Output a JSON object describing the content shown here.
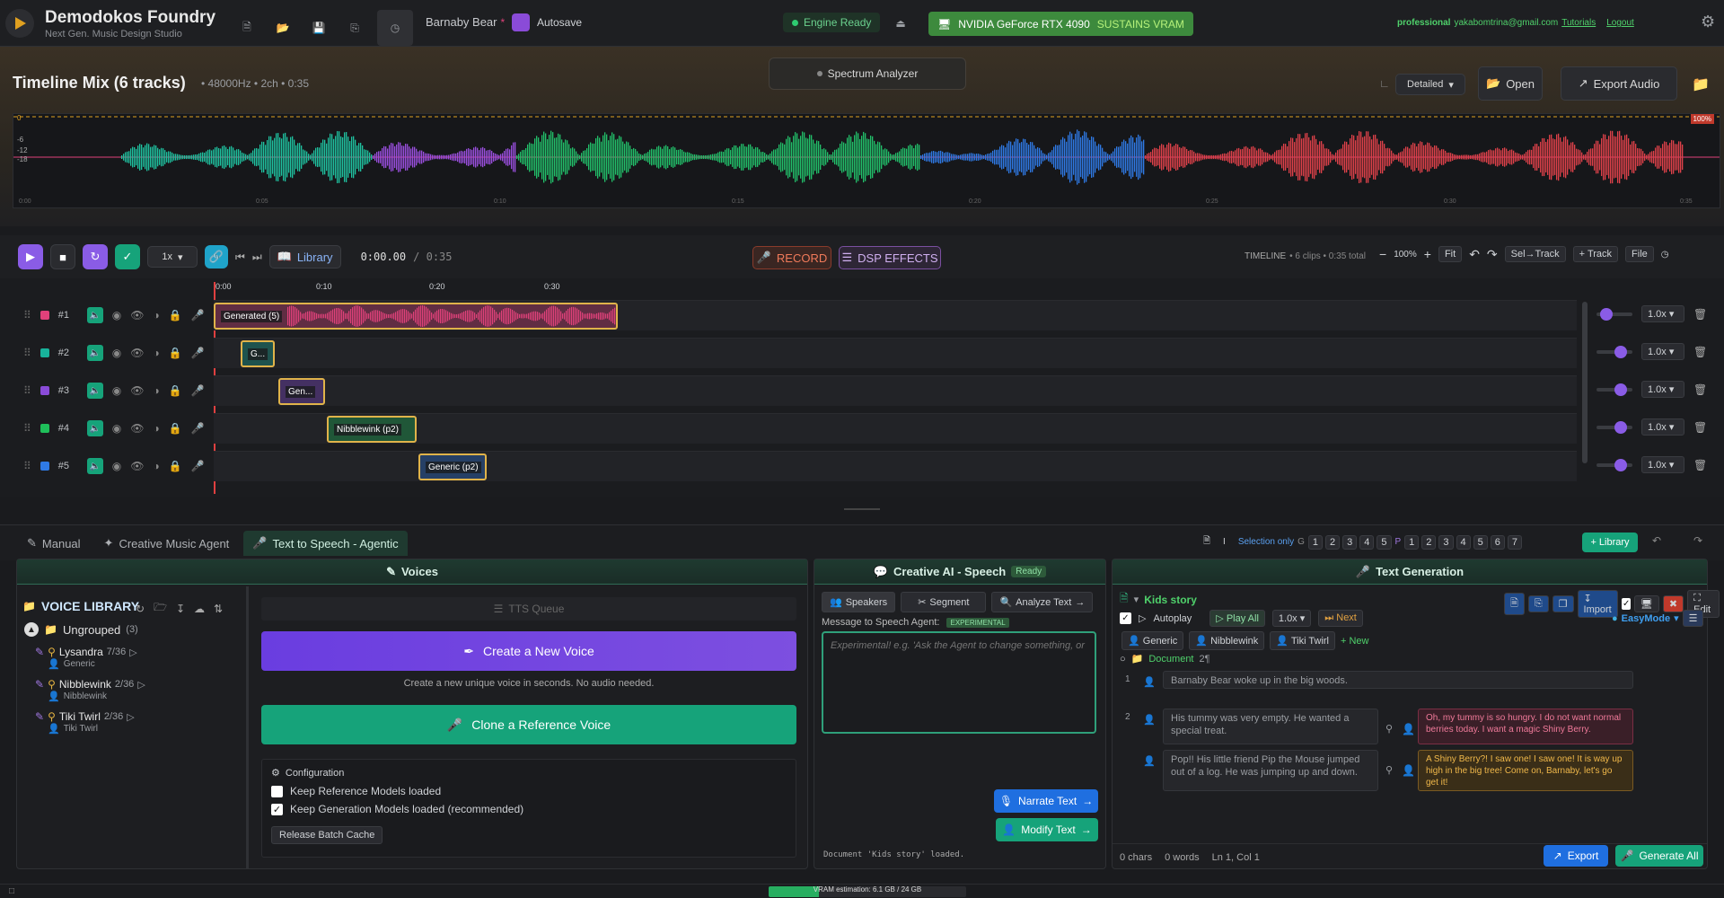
{
  "app": {
    "name": "Demodokos Foundry",
    "subtitle": "Next Gen. Music Design Studio"
  },
  "topbar": {
    "project": "Barnaby Bear",
    "unsaved": "*",
    "autosave": "Autosave",
    "engine": "Engine Ready",
    "gpu": "NVIDIA GeForce RTX 4090",
    "gpu_note": "SUSTAINS VRAM",
    "user": "professional",
    "email": "yakabomtrina@gmail.com",
    "tutorials": "Tutorials",
    "logout": "Logout"
  },
  "mix": {
    "title": "Timeline Mix (6 tracks)",
    "meta": "• 48000Hz • 2ch • 0:35",
    "spectrum": "Spectrum Analyzer",
    "view": "Detailed",
    "open": "Open",
    "export": "Export Audio",
    "db_labels": [
      "0",
      "-6",
      "-12",
      "-18"
    ],
    "time_labels": [
      "0:00",
      "0:05",
      "0:10",
      "0:15",
      "0:20",
      "0:25",
      "0:30",
      "0:35"
    ],
    "peak": "100%"
  },
  "transport": {
    "speed": "1x",
    "library": "Library",
    "time": "0:00.00",
    "duration": "/ 0:35",
    "record": "RECORD",
    "dsp": "DSP EFFECTS",
    "timeline_label": "TIMELINE",
    "timeline_info": "• 6 clips • 0:35 total",
    "zoom": "100%",
    "fit": "Fit",
    "seltrack": "Sel→Track",
    "addtrack": "+ Track",
    "file": "File"
  },
  "ruler": [
    "0:00",
    "0:10",
    "0:20",
    "0:30"
  ],
  "tracks": [
    {
      "num": "#1",
      "color": "#e0417a",
      "gain": "1.0x",
      "clip": "Generated (5)"
    },
    {
      "num": "#2",
      "color": "#18b39b",
      "gain": "1.0x",
      "clip": "G..."
    },
    {
      "num": "#3",
      "color": "#8a4bd8",
      "gain": "1.0x",
      "clip": "Gen..."
    },
    {
      "num": "#4",
      "color": "#1fbf5a",
      "gain": "1.0x",
      "clip": "Nibblewink (p2)"
    },
    {
      "num": "#5",
      "color": "#2f7ae5",
      "gain": "1.0x",
      "clip": "Generic (p2)"
    }
  ],
  "tabs": {
    "manual": "Manual",
    "music": "Creative Music Agent",
    "tts": "Text to Speech - Agentic",
    "selection": "Selection only",
    "library": "+ Library",
    "g_nums": [
      "1",
      "2",
      "3",
      "4",
      "5"
    ],
    "p_nums": [
      "1",
      "2",
      "3",
      "4",
      "5",
      "6",
      "7"
    ],
    "g": "G",
    "p": "P"
  },
  "voices": {
    "header": "Voices",
    "library_title": "VOICE LIBRARY",
    "group": "Ungrouped",
    "group_count": "(3)",
    "items": [
      {
        "name": "Lysandra",
        "count": "7/36",
        "sub": "Generic"
      },
      {
        "name": "Nibblewink",
        "count": "2/36",
        "sub": "Nibblewink"
      },
      {
        "name": "Tiki Twirl",
        "count": "2/36",
        "sub": "Tiki Twirl"
      }
    ],
    "tts_queue": "TTS Queue",
    "create": "Create a New Voice",
    "create_note": "Create a new unique voice in seconds. No audio needed.",
    "clone": "Clone a Reference Voice",
    "config": "Configuration",
    "keep_ref": "Keep Reference Models loaded",
    "keep_gen": "Keep Generation Models loaded (recommended)",
    "release": "Release Batch Cache"
  },
  "speech": {
    "header": "Creative AI - Speech",
    "status": "Ready",
    "speakers": "Speakers",
    "segment": "Segment",
    "analyze": "Analyze Text",
    "msg_label": "Message to Speech Agent:",
    "experimental": "EXPERIMENTAL",
    "placeholder": "Experimental! e.g. 'Ask the Agent to change something, or",
    "narrate": "Narrate Text",
    "modify": "Modify Text",
    "log": "Document 'Kids story' loaded."
  },
  "textgen": {
    "header": "Text Generation",
    "doc": "Kids story",
    "import": "Import",
    "edit": "Edit",
    "autoplay": "Autoplay",
    "playall": "Play All",
    "speed": "1.0x",
    "next": "Next",
    "easymode": "EasyMode",
    "speakers": [
      "Generic",
      "Nibblewink",
      "Tiki Twirl"
    ],
    "new": "+ New",
    "document": "Document",
    "doc_count": "2¶",
    "lines": [
      {
        "n": "1",
        "text": "Barnaby Bear woke up in the big woods."
      },
      {
        "n": "2",
        "text": "His tummy was very empty. He wanted a special treat.",
        "reply": "Oh, my tummy is so hungry. I do not want normal berries today. I want a magic Shiny Berry."
      },
      {
        "n": "",
        "text": "Pop!! His little friend Pip the Mouse jumped out of a log. He was jumping up and down.",
        "reply": "A Shiny Berry?! I saw one! I saw one! It is way up high in the big tree! Come on, Barnaby, let's go get it!"
      }
    ],
    "chars": "0 chars",
    "words": "0 words",
    "pos": "Ln 1, Col 1",
    "export": "Export",
    "generate": "Generate All"
  },
  "status": {
    "vram": "VRAM estimation: 6.1 GB / 24 GB"
  }
}
